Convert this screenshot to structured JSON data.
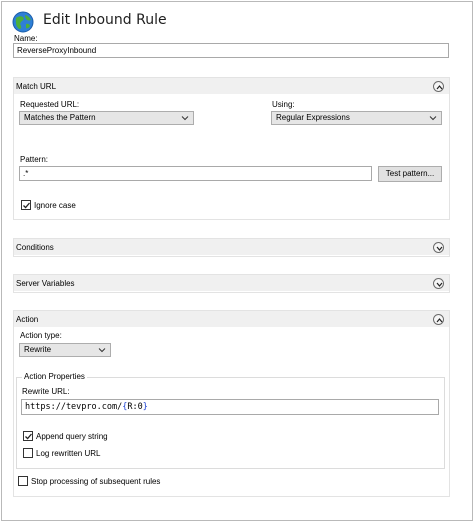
{
  "window": {
    "title": "Edit Inbound Rule",
    "icon": "globe-icon"
  },
  "name": {
    "label": "Name:",
    "value": "ReverseProxyInbound"
  },
  "match_url": {
    "heading": "Match URL",
    "requested_url_label": "Requested URL:",
    "requested_url_value": "Matches the Pattern",
    "using_label": "Using:",
    "using_value": "Regular Expressions",
    "pattern_label": "Pattern:",
    "pattern_value": ".*",
    "test_pattern_button": "Test pattern...",
    "ignore_case_label": "Ignore case",
    "ignore_case_checked": true
  },
  "conditions": {
    "heading": "Conditions"
  },
  "server_variables": {
    "heading": "Server Variables"
  },
  "action": {
    "heading": "Action",
    "type_label": "Action type:",
    "type_value": "Rewrite",
    "properties_legend": "Action Properties",
    "rewrite_url_label": "Rewrite URL:",
    "rewrite_url_prefix": "https://tevpro.com/",
    "rewrite_url_var_open": "{",
    "rewrite_url_var_name": "R:0",
    "rewrite_url_var_close": "}",
    "append_query_label": "Append query string",
    "append_query_checked": true,
    "log_rewritten_label": "Log rewritten URL",
    "log_rewritten_checked": false,
    "stop_processing_label": "Stop processing of subsequent rules",
    "stop_processing_checked": false
  },
  "colors": {
    "border": "#a9a9a9",
    "section_header": "#f0f0f0",
    "variable": "#1a3fd0"
  }
}
